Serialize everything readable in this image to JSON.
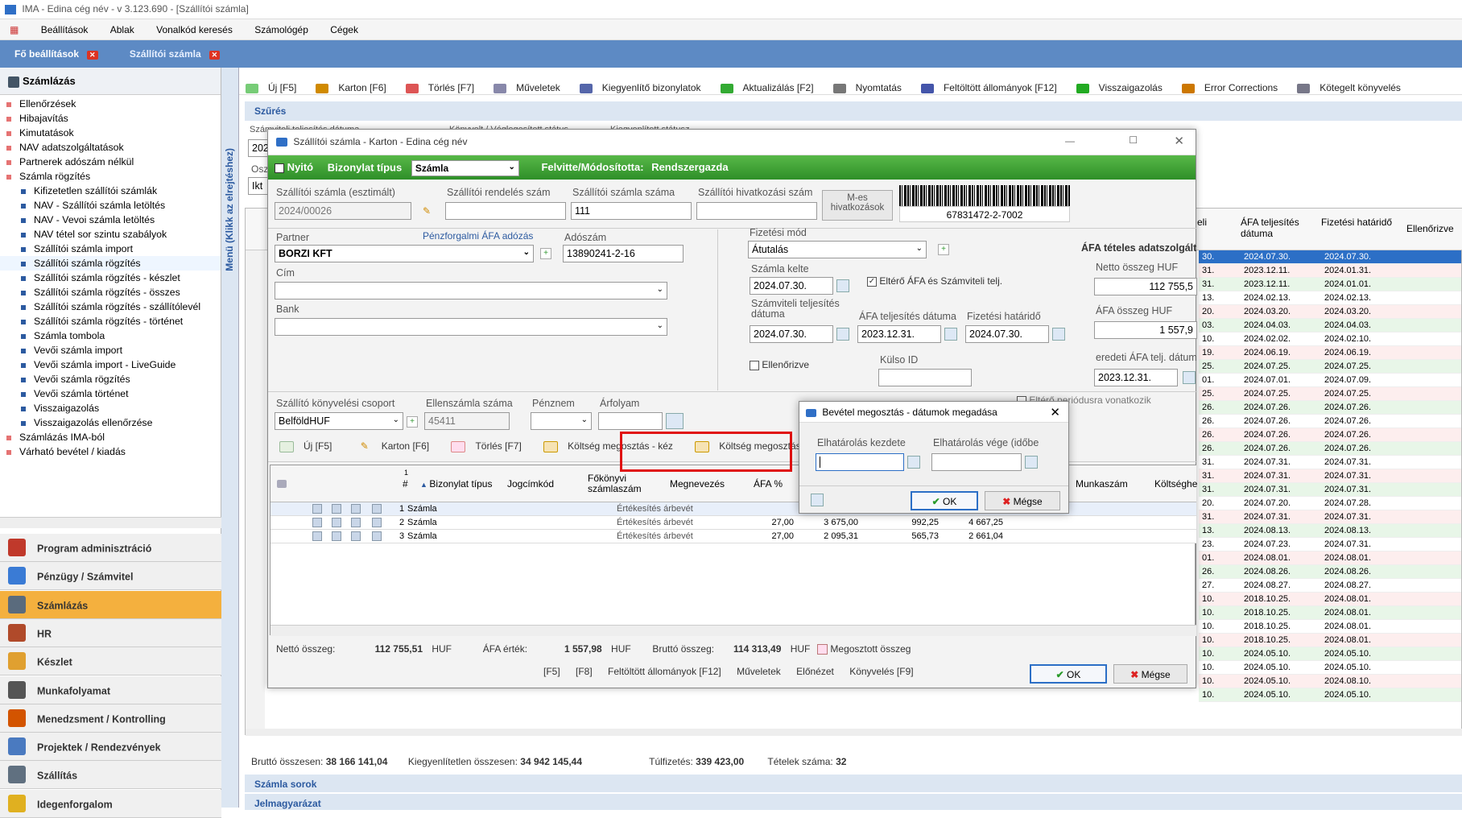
{
  "app": {
    "title": "IMA - Edina cég név - v 3.123.690 - [Szállítói számla]"
  },
  "menu": [
    "Beállítások",
    "Ablak",
    "Vonalkód keresés",
    "Számológép",
    "Cégek"
  ],
  "tabs": [
    {
      "label": "Fő beállítások"
    },
    {
      "label": "Szállítói számla"
    }
  ],
  "sidebar": {
    "header": "Számlázás",
    "collapse_label": "Menü (Klikk az elrejtéshez)",
    "items": [
      {
        "label": "Ellenőrzések",
        "sub": false
      },
      {
        "label": "Hibajavítás",
        "sub": false
      },
      {
        "label": "Kimutatások",
        "sub": false
      },
      {
        "label": "NAV adatszolgáltatások",
        "sub": false
      },
      {
        "label": "Partnerek adószám nélkül",
        "sub": false
      },
      {
        "label": "Számla rögzítés",
        "sub": false
      },
      {
        "label": "Kifizetetlen szállítói számlák",
        "sub": true
      },
      {
        "label": "NAV - Szállítói számla letöltés",
        "sub": true
      },
      {
        "label": "NAV - Vevoi számla letöltés",
        "sub": true
      },
      {
        "label": "NAV tétel sor szintu szabályok",
        "sub": true
      },
      {
        "label": "Szállítói számla import",
        "sub": true
      },
      {
        "label": "Szállítói számla rögzítés",
        "sub": true
      },
      {
        "label": "Szállítói számla rögzítés - készlet",
        "sub": true
      },
      {
        "label": "Szállítói számla rögzítés - összes",
        "sub": true
      },
      {
        "label": "Szállítói számla rögzítés - szállítólevél",
        "sub": true
      },
      {
        "label": "Szállítói számla rögzítés - történet",
        "sub": true
      },
      {
        "label": "Számla tombola",
        "sub": true
      },
      {
        "label": "Vevői számla import",
        "sub": true
      },
      {
        "label": "Vevői számla import - LiveGuide",
        "sub": true
      },
      {
        "label": "Vevői számla rögzítés",
        "sub": true
      },
      {
        "label": "Vevői számla történet",
        "sub": true
      },
      {
        "label": "Visszaigazolás",
        "sub": true
      },
      {
        "label": "Visszaigazolás ellenőrzése",
        "sub": true
      },
      {
        "label": "Számlázás IMA-ból",
        "sub": false
      },
      {
        "label": "Várható bevétel / kiadás",
        "sub": false
      }
    ],
    "modules": [
      {
        "label": "Program adminisztráció",
        "color": "#c0392b"
      },
      {
        "label": "Pénzügy / Számvitel",
        "color": "#3a7bd5"
      },
      {
        "label": "Számlázás",
        "color": "#5a6b7d"
      },
      {
        "label": "HR",
        "color": "#b04a2a"
      },
      {
        "label": "Készlet",
        "color": "#e0a030"
      },
      {
        "label": "Munkafolyamat",
        "color": "#555555"
      },
      {
        "label": "Menedzsment / Kontrolling",
        "color": "#d35400"
      },
      {
        "label": "Projektek / Rendezvények",
        "color": "#4a7ac0"
      },
      {
        "label": "Szállítás",
        "color": "#607080"
      },
      {
        "label": "Idegenforgalom",
        "color": "#e0b020"
      }
    ]
  },
  "toolbar": [
    "Új [F5]",
    "Karton [F6]",
    "Törlés [F7]",
    "Műveletek",
    "Kiegyenlítő bizonylatok",
    "Aktualizálás [F2]",
    "Nyomtatás",
    "Feltöltött állományok [F12]",
    "Visszaigazolás",
    "Error Corrections",
    "Kötegelt könyvelés"
  ],
  "filter": {
    "title": "Szűrés",
    "f1": "Számviteli teljesítés dátuma",
    "f2": "Könyvelt / Véglegesített státus",
    "f3": "Kiegyenlített státusz",
    "v1": "202",
    "v2": "Ikt",
    "osz": "Osz"
  },
  "right_table": {
    "headers": [
      "eli",
      "ÁFA teljesítés dátuma",
      "Fizetési határidő",
      "Ellenőrizve"
    ],
    "rows": [
      [
        "30.",
        "2024.07.30.",
        "2024.07.30."
      ],
      [
        "31.",
        "2023.12.11.",
        "2024.01.31."
      ],
      [
        "31.",
        "2023.12.11.",
        "2024.01.01."
      ],
      [
        "13.",
        "2024.02.13.",
        "2024.02.13."
      ],
      [
        "20.",
        "2024.03.20.",
        "2024.03.20."
      ],
      [
        "03.",
        "2024.04.03.",
        "2024.04.03."
      ],
      [
        "10.",
        "2024.02.02.",
        "2024.02.10."
      ],
      [
        "19.",
        "2024.06.19.",
        "2024.06.19."
      ],
      [
        "25.",
        "2024.07.25.",
        "2024.07.25."
      ],
      [
        "01.",
        "2024.07.01.",
        "2024.07.09."
      ],
      [
        "25.",
        "2024.07.25.",
        "2024.07.25."
      ],
      [
        "26.",
        "2024.07.26.",
        "2024.07.26."
      ],
      [
        "26.",
        "2024.07.26.",
        "2024.07.26."
      ],
      [
        "26.",
        "2024.07.26.",
        "2024.07.26."
      ],
      [
        "26.",
        "2024.07.26.",
        "2024.07.26."
      ],
      [
        "31.",
        "2024.07.31.",
        "2024.07.31."
      ],
      [
        "31.",
        "2024.07.31.",
        "2024.07.31."
      ],
      [
        "31.",
        "2024.07.31.",
        "2024.07.31."
      ],
      [
        "20.",
        "2024.07.20.",
        "2024.07.28."
      ],
      [
        "31.",
        "2024.07.31.",
        "2024.07.31."
      ],
      [
        "13.",
        "2024.08.13.",
        "2024.08.13."
      ],
      [
        "23.",
        "2024.07.23.",
        "2024.07.31."
      ],
      [
        "01.",
        "2024.08.01.",
        "2024.08.01."
      ],
      [
        "26.",
        "2024.08.26.",
        "2024.08.26."
      ],
      [
        "27.",
        "2024.08.27.",
        "2024.08.27."
      ],
      [
        "10.",
        "2018.10.25.",
        "2024.08.01."
      ],
      [
        "10.",
        "2018.10.25.",
        "2024.08.01."
      ],
      [
        "10.",
        "2018.10.25.",
        "2024.08.01."
      ],
      [
        "10.",
        "2018.10.25.",
        "2024.08.01."
      ],
      [
        "10.",
        "2024.05.10.",
        "2024.05.10."
      ],
      [
        "10.",
        "2024.05.10.",
        "2024.05.10."
      ],
      [
        "10.",
        "2024.05.10.",
        "2024.08.10."
      ],
      [
        "10.",
        "2024.05.10.",
        "2024.05.10."
      ]
    ]
  },
  "footer": {
    "brutto_label": "Bruttó összesen:",
    "brutto": "38 166 141,04",
    "kiegy_label": "Kiegyenlítetlen összesen:",
    "kiegy": "34 942 145,44",
    "tulfiz_label": "Túlfizetés:",
    "tulfiz": "339 423,00",
    "tetelek_label": "Tételek száma:",
    "tetelek": "32",
    "szamla_sorok": "Számla sorok",
    "jelmagyarazat": "Jelmagyarázat"
  },
  "karton": {
    "title": "Szállítói számla - Karton  - Edina cég név",
    "nyito": "Nyitó",
    "bizonylat_tipus_label": "Bizonylat típus",
    "bizonylat_tipus": "Számla",
    "felvitte_label": "Felvitte/Módosította:",
    "felvitte": "Rendszergazda",
    "l_szamla": "Szállítói számla (esztimált)",
    "szamla": "2024/00026",
    "l_rendeles": "Szállítói rendelés szám",
    "l_szamla_szama": "Szállítói számla száma",
    "szamla_szama": "111",
    "l_hivatkozasi": "Szállítói hivatkozási szám",
    "m_es": "M-es hivatkozások",
    "barcode": "67831472-2-7002",
    "l_partner": "Partner",
    "penzforgalmi": "Pénzforgalmi ÁFA adózás",
    "partner": "BORZI KFT",
    "l_adoszam": "Adószám",
    "adoszam": "13890241-2-16",
    "l_cim": "Cím",
    "l_bank": "Bank",
    "l_fizmod": "Fizetési mód",
    "fizmod": "Átutalás",
    "l_kelte": "Számla kelte",
    "kelte": "2024.07.30.",
    "elero": "Eltérő ÁFA és Számviteli telj.",
    "l_szamv": "Számviteli teljesítés dátuma",
    "szamv": "2024.07.30.",
    "l_afatelj": "ÁFA teljesítés dátuma",
    "afatelj": "2023.12.31.",
    "l_fizhat": "Fizetési határidő",
    "fizhat": "2024.07.30.",
    "ellenorizve": "Ellenőrizve",
    "l_kulso": "Külso ID",
    "afa_tetel": "ÁFA tételes adatszolgált",
    "l_netto": "Netto összeg HUF",
    "netto": "112 755,5",
    "l_afaossz": "ÁFA összeg HUF",
    "afaossz": "1 557,9",
    "l_eredeti": "eredeti ÁFA telj. dátum",
    "eredeti": "2023.12.31.",
    "l_csoport": "Szállító könyvelési csoport",
    "csoport": "BelföldHUF",
    "l_ellen": "Ellenszámla száma",
    "ellen": "45411",
    "l_penznem": "Pénznem",
    "l_arfolyam": "Árfolyam",
    "eltero_per": "Eltérő periódusra vonatkozik",
    "subtb": [
      "Új [F5]",
      "Karton [F6]",
      "Törlés [F7]",
      "Költség megosztás - kéz",
      "Költség megosztás - automatikus"
    ],
    "grid_headers": [
      "#",
      "Bizonylat típus",
      "Jogcímkód",
      "Főkönyvi számlaszám",
      "Megnevezés",
      "ÁFA %",
      "Munkaszám",
      "Költséghe"
    ],
    "grid_rows": [
      {
        "n": "1",
        "tipus": "Számla",
        "megn": "Értékesítés árbevét",
        "afa": "",
        "a": "",
        "b": "",
        "c": ""
      },
      {
        "n": "2",
        "tipus": "Számla",
        "megn": "Értékesítés árbevét",
        "afa": "27,00",
        "a": "3 675,00",
        "b": "992,25",
        "c": "4 667,25"
      },
      {
        "n": "3",
        "tipus": "Számla",
        "megn": "Értékesítés árbevét",
        "afa": "27,00",
        "a": "2 095,31",
        "b": "565,73",
        "c": "2 661,04"
      }
    ],
    "l_nettoossz": "Nettó összeg:",
    "nettoossz": "112 755,51",
    "huf": "HUF",
    "l_afaertek": "ÁFA érték:",
    "afaertek": "1 557,98",
    "l_bruttoossz": "Bruttó összeg:",
    "bruttoossz": "114 313,49",
    "megosztott": "Megosztott összeg",
    "bottom": [
      "[F5]",
      "[F8]",
      "Feltöltött állományok [F12]",
      "Műveletek",
      "Előnézet",
      "Könyvelés [F9]"
    ],
    "ok": "OK",
    "megse": "Mégse"
  },
  "dialog": {
    "title": "Bevétel megosztás - dátumok megadása",
    "l_kezdete": "Elhatárolás kezdete",
    "l_vege": "Elhatárolás vége (időbe",
    "ok": "OK",
    "megse": "Mégse"
  }
}
